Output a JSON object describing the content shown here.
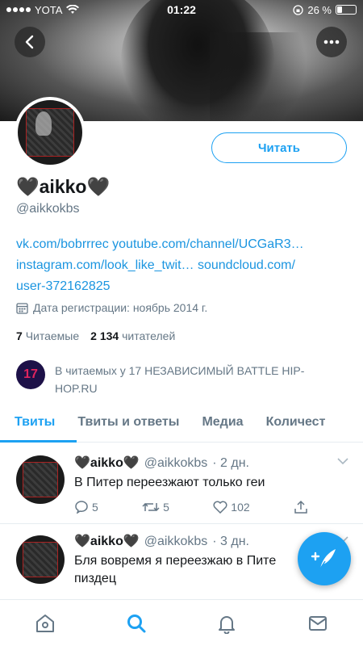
{
  "status_bar": {
    "carrier": "YOTA",
    "time": "01:22",
    "battery": "26 %",
    "battery_level": 0.26
  },
  "profile": {
    "name": "🖤aikko🖤",
    "handle": "@aikkokbs",
    "follow_button": "Читать",
    "bio_line1": "vk.com/bobrrrec youtube.com/channel/UCGaR3…",
    "bio_line2": "instagram.com/look_like_twit… soundcloud.com/",
    "bio_line3": "user-372162825",
    "joined": "Дата регистрации: ноябрь 2014 г.",
    "following_count": "7",
    "following_label": "Читаемые",
    "followers_count": "2 134",
    "followers_label": "читателей",
    "followed_by_line1": "В читаемых у 17 НЕЗАВИСИМЫЙ BATTLE HIP-",
    "followed_by_line2": "HOP.RU",
    "followed_by_avatar": "17"
  },
  "tabs": [
    {
      "label": "Твиты",
      "active": true
    },
    {
      "label": "Твиты и ответы",
      "active": false
    },
    {
      "label": "Медиа",
      "active": false
    },
    {
      "label": "Количест",
      "active": false
    }
  ],
  "tweets": [
    {
      "name": "🖤aikko🖤",
      "handle": "@aikkokbs",
      "time": "· 2 дн.",
      "text": "В Питер переезжают только геи",
      "replies": "5",
      "retweets": "5",
      "likes": "102"
    },
    {
      "name": "🖤aikko🖤",
      "handle": "@aikkokbs",
      "time": "· 3 дн.",
      "text_line1": "Бля вовремя я переезжаю в Пите",
      "text_line2": "пиздец"
    }
  ],
  "colors": {
    "accent": "#1da1f2",
    "text": "#14171a",
    "secondary": "#657786"
  }
}
